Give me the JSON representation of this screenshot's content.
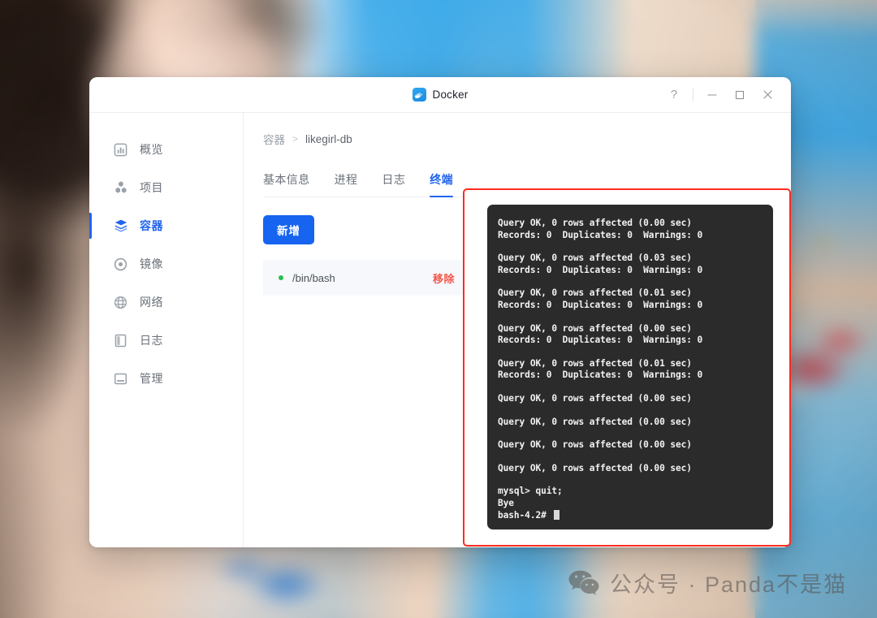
{
  "window": {
    "title": "Docker",
    "logo_icon": "docker-whale-icon",
    "controls": {
      "help": "?",
      "minimize_icon": "minimize-icon",
      "maximize_icon": "maximize-icon",
      "close_icon": "close-icon"
    }
  },
  "sidebar": {
    "items": [
      {
        "label": "概览",
        "icon": "chart-bar-icon",
        "active": false
      },
      {
        "label": "项目",
        "icon": "molecule-icon",
        "active": false
      },
      {
        "label": "容器",
        "icon": "cube-stack-icon",
        "active": true
      },
      {
        "label": "镜像",
        "icon": "disc-icon",
        "active": false
      },
      {
        "label": "网络",
        "icon": "globe-icon",
        "active": false
      },
      {
        "label": "日志",
        "icon": "book-icon",
        "active": false
      },
      {
        "label": "管理",
        "icon": "server-icon",
        "active": false
      }
    ]
  },
  "breadcrumb": {
    "root": "容器",
    "separator": ">",
    "current": "likegirl-db"
  },
  "tabs": [
    {
      "label": "基本信息",
      "active": false
    },
    {
      "label": "进程",
      "active": false
    },
    {
      "label": "日志",
      "active": false
    },
    {
      "label": "终端",
      "active": true
    }
  ],
  "toolbar": {
    "add_label": "新增"
  },
  "sessions": [
    {
      "status": "running",
      "status_color": "#2bbd51",
      "name": "/bin/bash",
      "remove_label": "移除"
    }
  ],
  "terminal": {
    "blocks": [
      [
        "Query OK, 0 rows affected (0.00 sec)",
        "Records: 0  Duplicates: 0  Warnings: 0"
      ],
      [
        "Query OK, 0 rows affected (0.03 sec)",
        "Records: 0  Duplicates: 0  Warnings: 0"
      ],
      [
        "Query OK, 0 rows affected (0.01 sec)",
        "Records: 0  Duplicates: 0  Warnings: 0"
      ],
      [
        "Query OK, 0 rows affected (0.00 sec)",
        "Records: 0  Duplicates: 0  Warnings: 0"
      ],
      [
        "Query OK, 0 rows affected (0.01 sec)",
        "Records: 0  Duplicates: 0  Warnings: 0"
      ],
      [
        "Query OK, 0 rows affected (0.00 sec)"
      ],
      [
        "Query OK, 0 rows affected (0.00 sec)"
      ],
      [
        "Query OK, 0 rows affected (0.00 sec)"
      ],
      [
        "Query OK, 0 rows affected (0.00 sec)"
      ],
      [
        "mysql> quit;",
        "Bye",
        "bash-4.2# "
      ]
    ]
  },
  "annotation": {
    "color": "#ff2b1f"
  },
  "watermark": {
    "icon": "wechat-icon",
    "text": "公众号 · Panda不是猫"
  },
  "colors": {
    "accent": "#2164ef",
    "button": "#1664f0",
    "danger": "#f5554a",
    "status_running": "#2bbd51",
    "terminal_bg": "#2b2b2b",
    "annotation": "#ff2b1f"
  }
}
